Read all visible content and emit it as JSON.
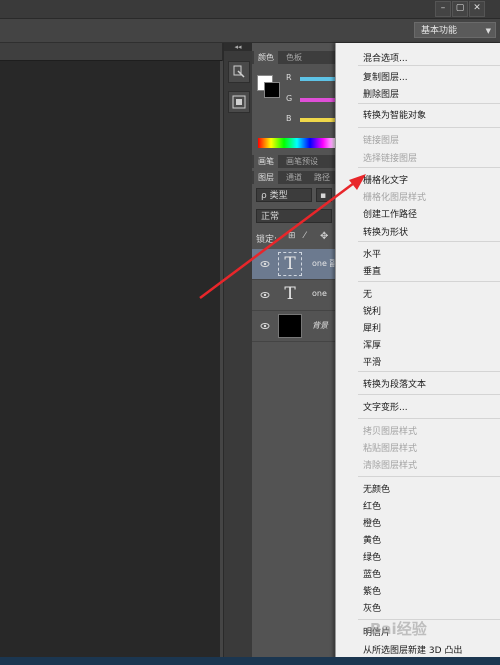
{
  "workspace": {
    "label": "基本功能"
  },
  "window_controls": [
    "–",
    "▢",
    "✕"
  ],
  "color_panel": {
    "tabs": [
      "颜色",
      "色板"
    ],
    "channels": [
      "R",
      "G",
      "B"
    ],
    "colors": {
      "r_bar": "#5ec3e6",
      "g_bar": "#e04fd8",
      "b_bar": "#f0d84a"
    }
  },
  "brush_tabs": [
    "画笔",
    "画笔预设"
  ],
  "layers_panel": {
    "tabs": [
      "图层",
      "通道",
      "路径"
    ],
    "filter_label": "ρ 类型",
    "blend_mode": "正常",
    "lock_label": "锁定:",
    "layers": [
      {
        "name": "one 副",
        "type": "text",
        "selected": true
      },
      {
        "name": "one",
        "type": "text",
        "selected": false
      },
      {
        "name": "背景",
        "type": "background",
        "selected": false
      }
    ],
    "text_glyph": "T"
  },
  "context_menu": {
    "items": [
      {
        "label": "混合选项...",
        "disabled": false
      },
      {
        "sep": true
      },
      {
        "label": "复制图层...",
        "disabled": false
      },
      {
        "label": "删除图层",
        "disabled": false
      },
      {
        "sep": true
      },
      {
        "label": "转换为智能对象",
        "disabled": false
      },
      {
        "sep": true
      },
      {
        "label": "链接图层",
        "disabled": true
      },
      {
        "label": "选择链接图层",
        "disabled": true
      },
      {
        "sep": true
      },
      {
        "label": "栅格化文字",
        "disabled": false,
        "highlighted": true
      },
      {
        "label": "栅格化图层样式",
        "disabled": true
      },
      {
        "label": "创建工作路径",
        "disabled": false
      },
      {
        "label": "转换为形状",
        "disabled": false
      },
      {
        "sep": true
      },
      {
        "label": "水平",
        "disabled": false
      },
      {
        "label": "垂直",
        "disabled": false
      },
      {
        "sep": true
      },
      {
        "label": "无",
        "disabled": false
      },
      {
        "label": "锐利",
        "disabled": false
      },
      {
        "label": "犀利",
        "disabled": false
      },
      {
        "label": "浑厚",
        "disabled": false
      },
      {
        "label": "平滑",
        "disabled": false
      },
      {
        "sep": true
      },
      {
        "label": "转换为段落文本",
        "disabled": false
      },
      {
        "sep": true
      },
      {
        "label": "文字变形...",
        "disabled": false
      },
      {
        "sep": true
      },
      {
        "label": "拷贝图层样式",
        "disabled": true
      },
      {
        "label": "粘贴图层样式",
        "disabled": true
      },
      {
        "label": "清除图层样式",
        "disabled": true
      },
      {
        "sep": true
      },
      {
        "label": "无颜色",
        "disabled": false
      },
      {
        "label": "红色",
        "disabled": false
      },
      {
        "label": "橙色",
        "disabled": false
      },
      {
        "label": "黄色",
        "disabled": false
      },
      {
        "label": "绿色",
        "disabled": false
      },
      {
        "label": "蓝色",
        "disabled": false
      },
      {
        "label": "紫色",
        "disabled": false
      },
      {
        "label": "灰色",
        "disabled": false
      },
      {
        "sep": true
      },
      {
        "label": "明信片",
        "disabled": false
      },
      {
        "label": "从所选图层新建 3D 凸出",
        "disabled": false
      }
    ]
  },
  "watermark": "Bai经验",
  "annotation": {
    "arrow_color": "#e8262a"
  }
}
